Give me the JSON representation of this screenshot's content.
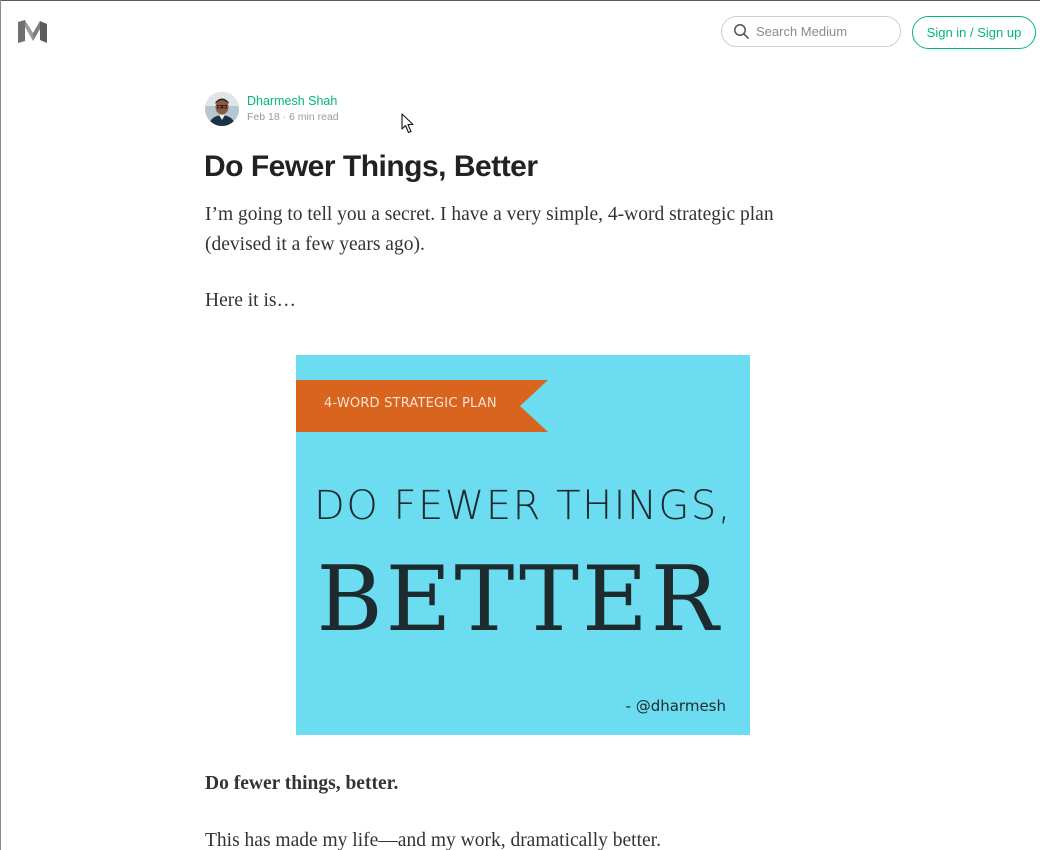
{
  "header": {
    "search_placeholder": "Search Medium",
    "signin_label": "Sign in / Sign up",
    "accent_color": "#02b875"
  },
  "author": {
    "name": "Dharmesh Shah",
    "meta": "Feb 18 · 6 min read"
  },
  "article": {
    "title": "Do Fewer Things, Better",
    "paragraph_1": "I’m going to tell you a secret. I have a very simple, 4-word strategic plan (devised it a few years ago).",
    "paragraph_2": "Here it is…",
    "paragraph_3": "Do fewer things, better.",
    "paragraph_4": "This has made my life—and my work, dramatically better."
  },
  "figure": {
    "ribbon_text": "4-WORD STRATEGIC PLAN",
    "line_1": "DO FEWER THINGS,",
    "line_2": "BETTER",
    "handle": "- @dharmesh",
    "background_color": "#6cdcf0",
    "ribbon_color": "#d8641e"
  },
  "icons": {
    "logo": "medium-logo-icon",
    "search": "search-icon",
    "cursor": "mouse-cursor-icon"
  }
}
